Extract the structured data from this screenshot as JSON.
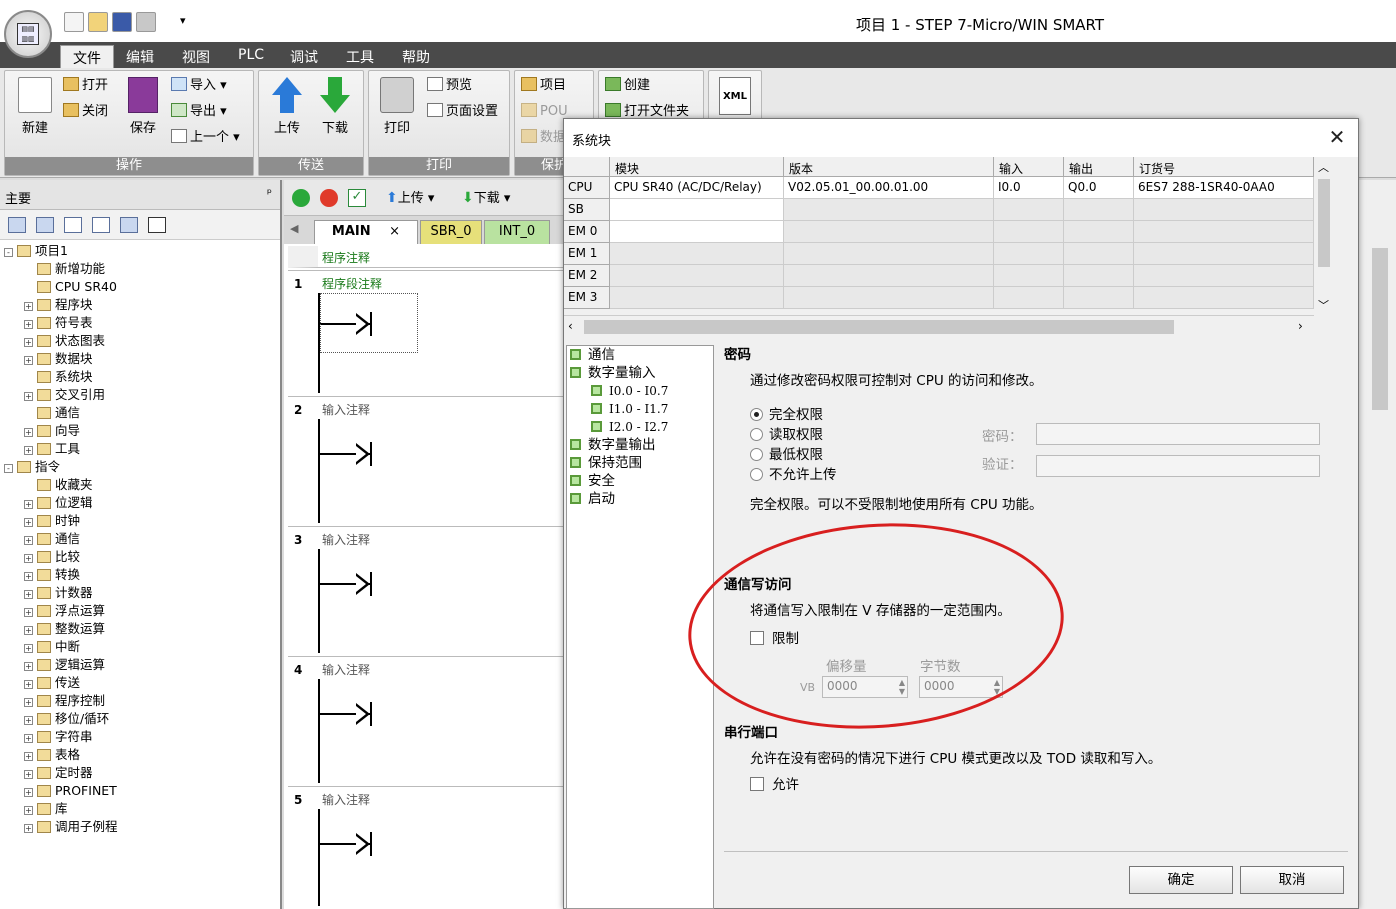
{
  "window": {
    "title": "项目 1 - STEP 7-Micro/WIN SMART"
  },
  "ribbon": {
    "tabs": [
      "文件",
      "编辑",
      "视图",
      "PLC",
      "调试",
      "工具",
      "帮助"
    ],
    "groups": {
      "operate": {
        "caption": "操作",
        "new": "新建",
        "open": "打开",
        "close": "关闭",
        "save": "保存",
        "import": "导入",
        "export": "导出",
        "previous": "上一个"
      },
      "transfer": {
        "caption": "传送",
        "upload": "上传",
        "download": "下载"
      },
      "print": {
        "caption": "打印",
        "print": "打印",
        "preview": "预览",
        "page_setup": "页面设置"
      },
      "protect": {
        "caption": "保护",
        "project": "项目",
        "pou": "POU",
        "data": "数据"
      },
      "library": {
        "create": "创建",
        "open_folder": "打开文件夹"
      },
      "xml": "XML"
    }
  },
  "left_panel": {
    "header": "主要",
    "pin": "ᵖ",
    "tree": [
      {
        "label": "项目1",
        "level": 0,
        "expander": "-"
      },
      {
        "label": "新增功能",
        "level": 1,
        "expander": ""
      },
      {
        "label": "CPU SR40",
        "level": 1,
        "expander": ""
      },
      {
        "label": "程序块",
        "level": 1,
        "expander": "+"
      },
      {
        "label": "符号表",
        "level": 1,
        "expander": "+"
      },
      {
        "label": "状态图表",
        "level": 1,
        "expander": "+"
      },
      {
        "label": "数据块",
        "level": 1,
        "expander": "+"
      },
      {
        "label": "系统块",
        "level": 1,
        "expander": ""
      },
      {
        "label": "交叉引用",
        "level": 1,
        "expander": "+"
      },
      {
        "label": "通信",
        "level": 1,
        "expander": ""
      },
      {
        "label": "向导",
        "level": 1,
        "expander": "+"
      },
      {
        "label": "工具",
        "level": 1,
        "expander": "+"
      },
      {
        "label": "指令",
        "level": 0,
        "expander": "-"
      },
      {
        "label": "收藏夹",
        "level": 1,
        "expander": ""
      },
      {
        "label": "位逻辑",
        "level": 1,
        "expander": "+"
      },
      {
        "label": "时钟",
        "level": 1,
        "expander": "+"
      },
      {
        "label": "通信",
        "level": 1,
        "expander": "+"
      },
      {
        "label": "比较",
        "level": 1,
        "expander": "+"
      },
      {
        "label": "转换",
        "level": 1,
        "expander": "+"
      },
      {
        "label": "计数器",
        "level": 1,
        "expander": "+"
      },
      {
        "label": "浮点运算",
        "level": 1,
        "expander": "+"
      },
      {
        "label": "整数运算",
        "level": 1,
        "expander": "+"
      },
      {
        "label": "中断",
        "level": 1,
        "expander": "+"
      },
      {
        "label": "逻辑运算",
        "level": 1,
        "expander": "+"
      },
      {
        "label": "传送",
        "level": 1,
        "expander": "+"
      },
      {
        "label": "程序控制",
        "level": 1,
        "expander": "+"
      },
      {
        "label": "移位/循环",
        "level": 1,
        "expander": "+"
      },
      {
        "label": "字符串",
        "level": 1,
        "expander": "+"
      },
      {
        "label": "表格",
        "level": 1,
        "expander": "+"
      },
      {
        "label": "定时器",
        "level": 1,
        "expander": "+"
      },
      {
        "label": "PROFINET",
        "level": 1,
        "expander": "+"
      },
      {
        "label": "库",
        "level": 1,
        "expander": "+"
      },
      {
        "label": "调用子例程",
        "level": 1,
        "expander": "+"
      }
    ]
  },
  "editor": {
    "toolbar": {
      "upload": "上传",
      "download": "下载"
    },
    "tabs": [
      "MAIN",
      "SBR_0",
      "INT_0"
    ],
    "tab_close": "×",
    "program_comment": "程序注释",
    "networks": [
      {
        "num": "1",
        "comment": "程序段注释"
      },
      {
        "num": "2",
        "comment": "输入注释"
      },
      {
        "num": "3",
        "comment": "输入注释"
      },
      {
        "num": "4",
        "comment": "输入注释"
      },
      {
        "num": "5",
        "comment": "输入注释"
      }
    ]
  },
  "dialog": {
    "title": "系统块",
    "close": "✕",
    "grid": {
      "headers": [
        "模块",
        "版本",
        "输入",
        "输出",
        "订货号"
      ],
      "rows": [
        {
          "slot": "CPU",
          "module": "CPU SR40 (AC/DC/Relay)",
          "version": "V02.05.01_00.00.01.00",
          "input": "I0.0",
          "output": "Q0.0",
          "order": "6ES7 288-1SR40-0AA0"
        },
        {
          "slot": "SB",
          "module": "",
          "version": "",
          "input": "",
          "output": "",
          "order": ""
        },
        {
          "slot": "EM 0",
          "module": "",
          "version": "",
          "input": "",
          "output": "",
          "order": ""
        },
        {
          "slot": "EM 1",
          "module": "",
          "version": "",
          "input": "",
          "output": "",
          "order": ""
        },
        {
          "slot": "EM 2",
          "module": "",
          "version": "",
          "input": "",
          "output": "",
          "order": ""
        },
        {
          "slot": "EM 3",
          "module": "",
          "version": "",
          "input": "",
          "output": "",
          "order": ""
        }
      ]
    },
    "tree": [
      {
        "label": "通信",
        "indent": 0
      },
      {
        "label": "数字量输入",
        "indent": 0
      },
      {
        "label": "I0.0 - I0.7",
        "indent": 1
      },
      {
        "label": "I1.0 - I1.7",
        "indent": 1
      },
      {
        "label": "I2.0 - I2.7",
        "indent": 1
      },
      {
        "label": "数字量输出",
        "indent": 0
      },
      {
        "label": "保持范围",
        "indent": 0
      },
      {
        "label": "安全",
        "indent": 0
      },
      {
        "label": "启动",
        "indent": 0
      }
    ],
    "password": {
      "title": "密码",
      "desc": "通过修改密码权限可控制对 CPU 的访问和修改。",
      "options": [
        "完全权限",
        "读取权限",
        "最低权限",
        "不允许上传"
      ],
      "selected": "完全权限",
      "password_label": "密码：",
      "verify_label": "验证：",
      "note": "完全权限。可以不受限制地使用所有 CPU 功能。"
    },
    "comm_write": {
      "title": "通信写访问",
      "desc": "将通信写入限制在 V 存储器的一定范围内。",
      "limit_label": "限制",
      "offset_label": "偏移量",
      "bytes_label": "字节数",
      "vb_label": "VB",
      "offset_value": "0000",
      "bytes_value": "0000"
    },
    "serial": {
      "title": "串行端口",
      "desc": "允许在没有密码的情况下进行 CPU 模式更改以及 TOD 读取和写入。",
      "allow_label": "允许"
    },
    "buttons": {
      "ok": "确定",
      "cancel": "取消"
    }
  },
  "colors": {
    "annotation_ellipse": "#d81f1f",
    "ribbon_tabbar": "#4a4a4a",
    "tree_square": "#5a9a3a"
  }
}
